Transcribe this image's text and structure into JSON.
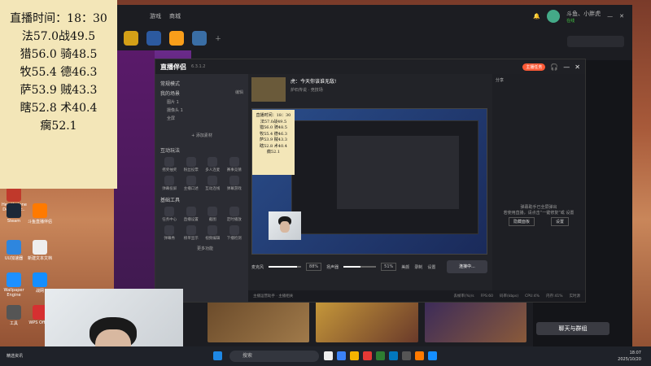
{
  "stats_overlay": {
    "lines": [
      "直播时间：18：30",
      "法57.0战49.5",
      "猎56.0 骑48.5",
      "牧55.4 德46.3",
      "萨53.9 贼43.3",
      "瞎52.8 术40.4",
      "瘸52.1"
    ]
  },
  "client": {
    "tab_games": "游戏",
    "tab_store": "商城",
    "user_name": "斗鱼、小胖虎",
    "user_status": "在线",
    "chat_button": "聊天与群组",
    "sidebar_text": "炉石传说",
    "broadcast_label": "播放服务"
  },
  "companion": {
    "app_name": "直播伴侣",
    "version": "6.3.1.2",
    "mode": "常规模式",
    "scene_section": "我的场景",
    "scene_edit": "编辑",
    "scene_mgr": "管理",
    "sources": [
      "图片 1",
      "摄像头 1",
      "全屏"
    ],
    "add_source": "+ 添加素材",
    "interact_section": "互动玩法",
    "interact_tools": [
      "摇奖抽奖",
      "粉丝投票",
      "多人连麦",
      "赛事竞猜",
      "弹幕投屏",
      "主播口述",
      "互动连线",
      "弹幕游戏"
    ],
    "basic_section": "基础工具",
    "basic_tools": [
      "任务中心",
      "直播设置",
      "截图",
      "定时播放",
      "弹幕秀",
      "榜单显示",
      "视频编辑",
      "下播检测"
    ],
    "more_tools": "更多功能",
    "room_title": "虎：今天你该谁无敌!",
    "room_sub": "炉石传说 · 竞技场",
    "live_badge": "主播任务",
    "share": "分享",
    "fans": "分享",
    "mic_label": "麦克风",
    "mic_pct": "88%",
    "speaker_label": "扬声器",
    "speaker_pct": "51%",
    "beauty": "美颜",
    "record": "录制",
    "settings": "设置",
    "live_button": "连接中...",
    "notice": "弹幕助手已全屏弹出",
    "notice_sub": "若使用直播，请点击“一键修复”或 设置",
    "btn_hide": "隐藏面板",
    "btn_set": "设置",
    "status": [
      "丢帧率(%)/s",
      "FPS:60",
      "码率(kbps)",
      "CPU:4%",
      "内存:41%",
      "实时源"
    ],
    "bottom_note": "主播运营助手 · 主播相关"
  },
  "taskbar": {
    "news": "精选资讯",
    "news_sub": "新闻·娱乐",
    "search": "搜索",
    "time": "18:07",
    "date": "2025/10/20"
  },
  "desktop": {
    "icons": [
      "Hearthstone Deck Trac..",
      "Steam",
      "斗鱼直播伴侣",
      "UU加速器",
      "新建文本文档",
      "Wallpaper Engine",
      "战网",
      "工具",
      "WPS Office"
    ]
  },
  "colors": {
    "accent": "#ff5a36",
    "overlay": "#f3e6b8"
  }
}
